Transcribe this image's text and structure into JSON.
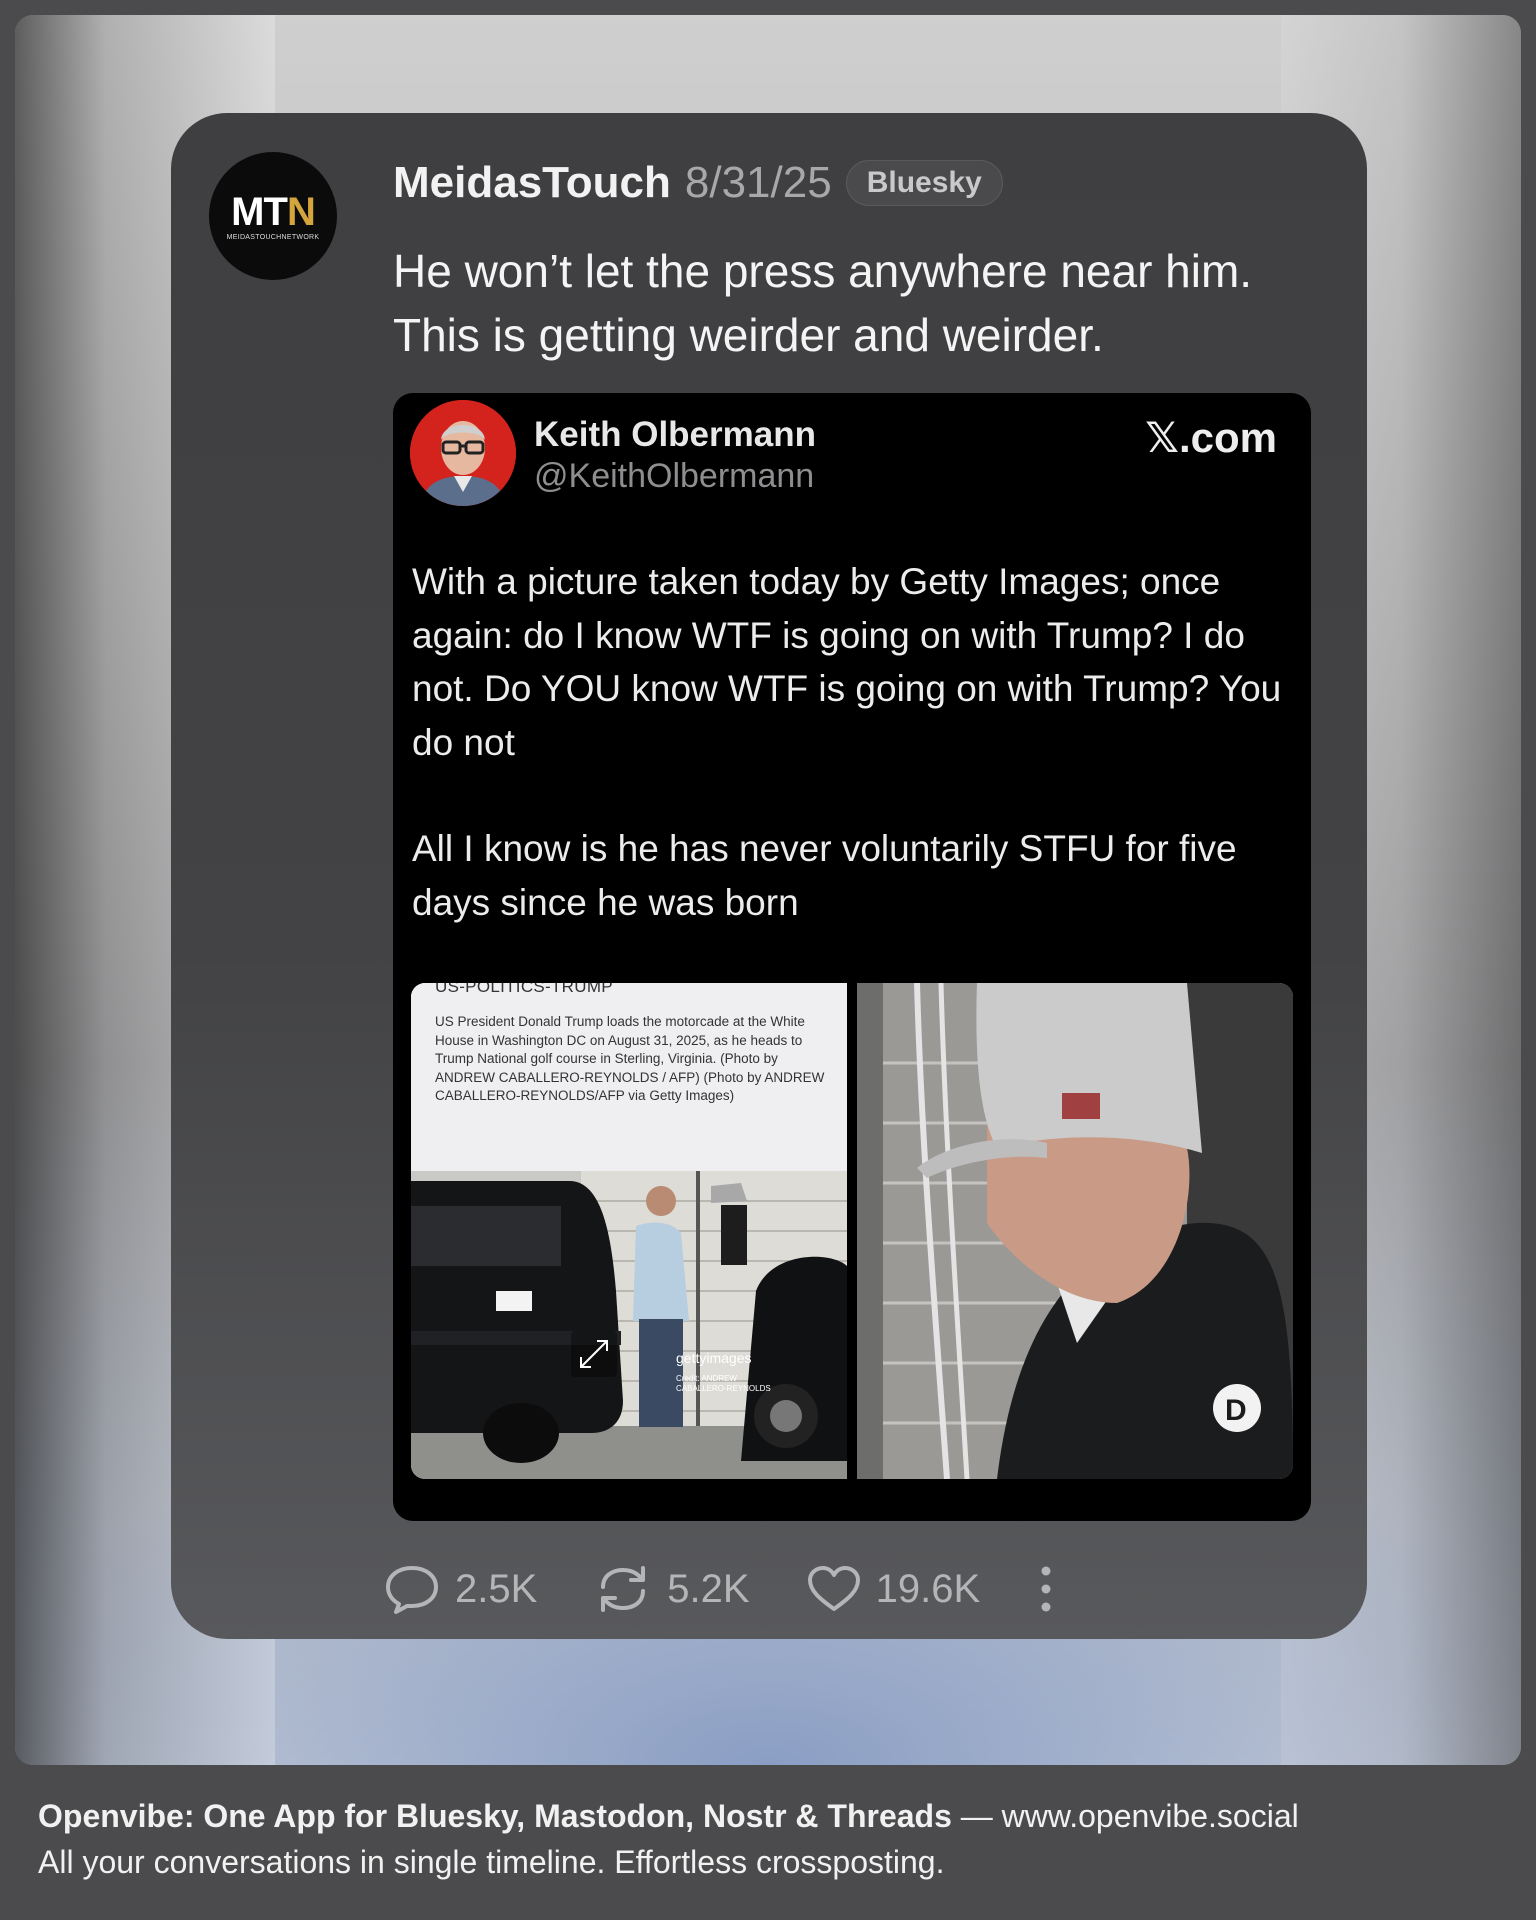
{
  "post": {
    "author": "MeidasTouch",
    "date": "8/31/25",
    "platform": "Bluesky",
    "avatar_text": "MTN",
    "avatar_subtext": "MEIDASTOUCHNETWORK",
    "text_line1": "He won’t let the press anywhere near him.",
    "text_line2": "This is getting weirder and weirder.",
    "stats": {
      "replies": "2.5K",
      "reposts": "5.2K",
      "likes": "19.6K"
    }
  },
  "embed": {
    "author": "Keith Olbermann",
    "handle": "@KeithOlbermann",
    "source": "𝕏.com",
    "paragraph1": "With a picture taken today by Getty Images; once again: do I know WTF is going on with Trump? I do not. Do YOU know WTF is going on with Trump? You do not",
    "paragraph2": "All I know is he has never voluntarily STFU for five days since he was born",
    "photo_caption_title": "US-POLITICS-TRUMP",
    "photo_caption": "US President Donald Trump loads the motorcade at the White House in Washington DC on August 31, 2025, as he heads to Trump National golf course in Sterling, Virginia. (Photo by ANDREW CABALLERO-REYNOLDS / AFP) (Photo by ANDREW CABALLERO-REYNOLDS/AFP via Getty Images)",
    "watermark": "gettyimages",
    "credit": "Credit: ANDREW CABALLERO-REYNOLDS"
  },
  "footer": {
    "title": "Openvibe: One App for Bluesky, Mastodon, Nostr & Threads",
    "dash": " — ",
    "url": "www.openvibe.social",
    "tagline": "All your conversations in single timeline. Effortless crossposting."
  },
  "colors": {
    "card": "#434345",
    "embed": "#000000",
    "text": "#f4f4f4",
    "muted": "#a8a8aa"
  }
}
